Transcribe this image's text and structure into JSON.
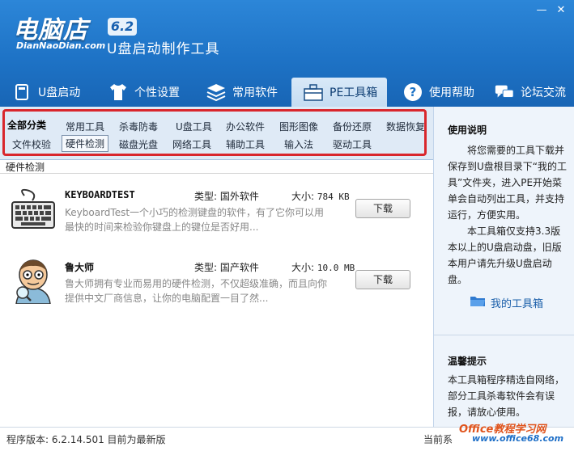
{
  "header": {
    "logo_main": "电脑店",
    "logo_sub": "DianNaoDian.com",
    "version": "6.2",
    "product_name": "U盘启动制作工具",
    "window_controls": [
      "—",
      "✕"
    ]
  },
  "nav": {
    "items": [
      {
        "label": "U盘启动",
        "icon": "usb-drive-icon"
      },
      {
        "label": "个性设置",
        "icon": "tshirt-icon"
      },
      {
        "label": "常用软件",
        "icon": "stack-icon"
      },
      {
        "label": "PE工具箱",
        "icon": "toolbox-icon"
      },
      {
        "label": "使用帮助",
        "icon": "help-icon"
      },
      {
        "label": "论坛交流",
        "icon": "chat-icon"
      }
    ],
    "active_index": 3
  },
  "categories": {
    "row1": [
      "全部分类",
      "常用工具",
      "杀毒防毒",
      "U盘工具",
      "办公软件",
      "图形图像",
      "备份还原",
      "数据恢复"
    ],
    "row2": [
      "文件校验",
      "硬件检测",
      "磁盘光盘",
      "网络工具",
      "辅助工具",
      "输入法",
      "驱动工具"
    ],
    "selected": "硬件检测"
  },
  "list": {
    "title": "硬件检测",
    "type_label": "类型:",
    "size_label": "大小:",
    "items": [
      {
        "name": "KEYBOARDTEST",
        "type": "国外软件",
        "size": "784 KB",
        "desc": "KeyboardTest一个小巧的检测键盘的软件，有了它你可以用最快的时间来检验你键盘上的键位是否好用...",
        "button": "下载",
        "icon": "keyboard-icon"
      },
      {
        "name": "鲁大师",
        "type": "国产软件",
        "size": "10.0 MB",
        "desc": "鲁大师拥有专业而易用的硬件检测，不仅超级准确，而且向你提供中文厂商信息，让你的电脑配置一目了然...",
        "button": "下载",
        "icon": "ludashi-avatar-icon"
      }
    ]
  },
  "right_panel": {
    "usage_title": "使用说明",
    "usage_text1": "将您需要的工具下载并保存到U盘根目录下“我的工具”文件夹，进入PE开始菜单会自动列出工具，并支持运行，方便实用。",
    "usage_text2": "本工具箱仅支持3.3版本以上的U盘启动盘，旧版本用户请先升级U盘启动盘。",
    "toolbox_link": "我的工具箱",
    "tips_title": "温馨提示",
    "tips_text": "本工具箱程序精选自网络，部分工具杀毒软件会有误报，请放心使用。"
  },
  "status": {
    "left": "程序版本: 6.2.14.501   目前为最新版",
    "right": "当前系"
  },
  "watermark": {
    "line1": "Office教程学习网",
    "line2": "www.office68.com"
  },
  "colors": {
    "header_blue": "#1e73c6",
    "highlight_red": "#d9262c",
    "link_blue": "#1b5faa"
  }
}
